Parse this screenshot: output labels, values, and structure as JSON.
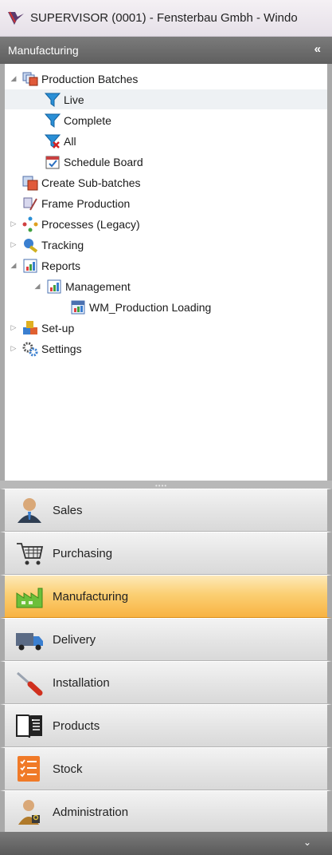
{
  "window": {
    "title": "SUPERVISOR (0001) - Fensterbau Gmbh - Windo"
  },
  "panel": {
    "title": "Manufacturing",
    "collapse_glyph": "«"
  },
  "tree": {
    "production_batches": "Production Batches",
    "live": "Live",
    "complete": "Complete",
    "all": "All",
    "schedule_board": "Schedule Board",
    "create_sub_batches": "Create Sub-batches",
    "frame_production": "Frame Production",
    "processes_legacy": "Processes (Legacy)",
    "tracking": "Tracking",
    "reports": "Reports",
    "management": "Management",
    "wm_production_loading": "WM_Production Loading",
    "setup": "Set-up",
    "settings": "Settings",
    "selected_item": "Live"
  },
  "nav": {
    "sales": "Sales",
    "purchasing": "Purchasing",
    "manufacturing": "Manufacturing",
    "delivery": "Delivery",
    "installation": "Installation",
    "products": "Products",
    "stock": "Stock",
    "administration": "Administration",
    "active": "Manufacturing"
  },
  "colors": {
    "active_nav": "#f8b342",
    "panel_header": "#6b6b6b",
    "filter_icon": "#2a8fd6"
  },
  "icons": [
    "batches-icon",
    "filter-icon",
    "filter-x-icon",
    "calendar-icon",
    "frame-icon",
    "processes-icon",
    "tracking-icon",
    "report-icon",
    "setup-icon",
    "settings-icon",
    "sales-icon",
    "cart-icon",
    "factory-icon",
    "truck-icon",
    "screwdriver-icon",
    "book-icon",
    "checklist-icon",
    "admin-icon",
    "chevron-down-icon"
  ]
}
